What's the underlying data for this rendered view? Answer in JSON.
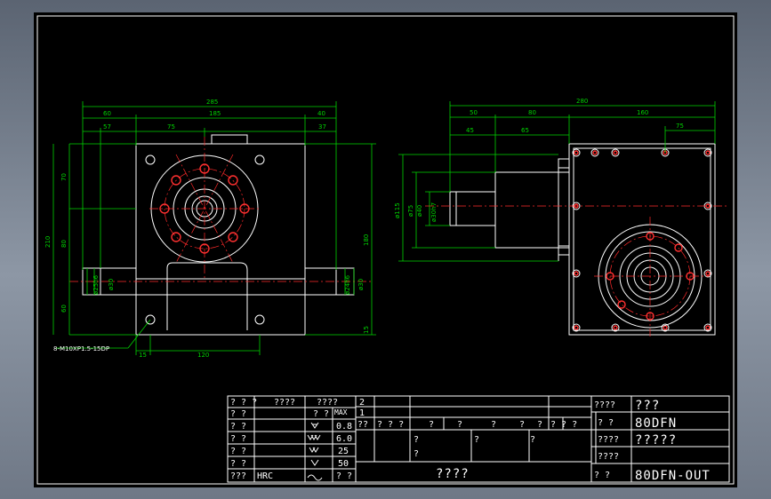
{
  "side_view": {
    "dims_top": {
      "overall": "285",
      "left": "60",
      "center": "185",
      "right": "40"
    },
    "dims_second": {
      "left": "57",
      "center": "75",
      "right": "37"
    },
    "dims_left": {
      "d1": "70",
      "d2": "80",
      "d3": "210",
      "d4": "60"
    },
    "dims_right": {
      "d1": "180",
      "d2": "15"
    },
    "dims_bottom": {
      "d1": "15",
      "d2": "120"
    },
    "shaft_left": {
      "d1": "ø25h6",
      "d2": "ø30"
    },
    "shaft_right": {
      "d1": "ø24h6",
      "d2": "ø30"
    },
    "leader": "8-M10XP1.5-15DP"
  },
  "front_view": {
    "dims_top": {
      "overall": "280",
      "a": "50",
      "b": "80",
      "c": "160",
      "d": "75"
    },
    "dims_second": {
      "a": "45",
      "b": "65"
    },
    "dims_left": {
      "d1": "ø115",
      "d2": "ø75",
      "d3": "ø40",
      "d4": "ø30h7"
    }
  },
  "title_block": {
    "left_rows": [
      {
        "label": "? ? ?",
        "mid": "????",
        "right": "????"
      },
      {
        "label": "? ?",
        "right": "? ?",
        "sym": "MAX"
      },
      {
        "label": "? ?",
        "right": "0.8",
        "sym": "tri1"
      },
      {
        "label": "? ?",
        "right": "6.0",
        "sym": "tri3"
      },
      {
        "label": "? ?",
        "right": "25",
        "sym": "tri2"
      },
      {
        "label": "? ?",
        "right": "50",
        "sym": "tri1b"
      },
      {
        "label": "???",
        "mid": "HRC",
        "right": "? ?",
        "sym": "tilde"
      }
    ],
    "rev_rows": [
      "2",
      "1"
    ],
    "header_row": [
      "??",
      "? ? ?",
      "?",
      "?",
      "?",
      "?",
      "?",
      "? ? ?"
    ],
    "sign_marks": [
      "?",
      "?",
      "?",
      "?"
    ],
    "center_label": "????",
    "right_rows": [
      {
        "label": "????",
        "value": "???"
      },
      {
        "label": "?  ?",
        "value": "80DFN"
      },
      {
        "label": "????",
        "value": "?????"
      },
      {
        "label": "????",
        "value": ""
      },
      {
        "label": "?  ?",
        "value": "80DFN-OUT"
      }
    ]
  }
}
